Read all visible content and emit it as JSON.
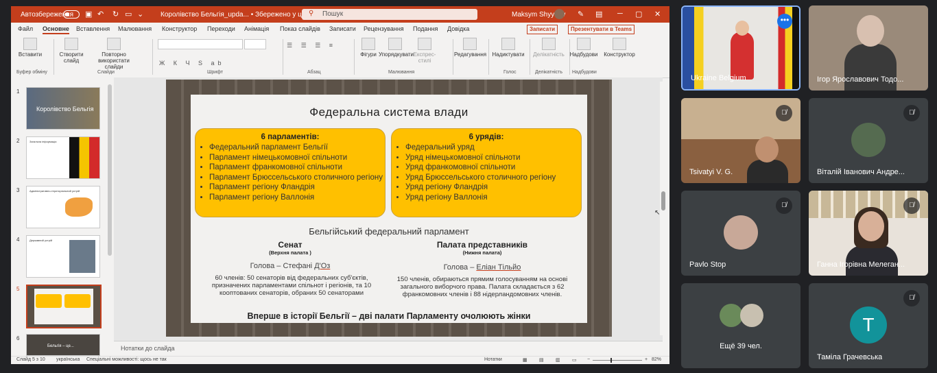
{
  "titlebar": {
    "autosave": "Автозбереження",
    "doc_title": "Королівство Бельгія_upda... • Збережено у цей ПК ⌄",
    "search_placeholder": "Пошук",
    "user": "Maksym Shyyaev"
  },
  "menu": {
    "items": [
      "Файл",
      "Основне",
      "Вставлення",
      "Малювання",
      "Конструктор",
      "Переходи",
      "Анімація",
      "Показ слайдів",
      "Записати",
      "Рецензування",
      "Подання",
      "Довідка"
    ],
    "record": "Записати",
    "present_teams": "Презентувати в Teams"
  },
  "ribbon": {
    "insert": "Вставити",
    "create_slide": "Створити слайд",
    "reuse": "Повторно використати слайди",
    "shapes": "Фігури",
    "arrange": "Упорядкувати",
    "express": "Експрес-стилі",
    "editing": "Редагування",
    "dictate": "Надиктувати",
    "sensitivity": "Делікатність",
    "addins": "Надбудови",
    "designer": "Конструктор",
    "groups": {
      "clipboard": "Буфер обміну",
      "slides": "Слайди",
      "font": "Шрифт",
      "paragraph": "Абзац",
      "drawing": "Малювання",
      "voice": "Голос",
      "sensitivity": "Делікатність",
      "addins": "Надбудови"
    }
  },
  "thumbnails": {
    "nums": [
      "1",
      "2",
      "3",
      "4",
      "5",
      "6"
    ],
    "t1_title": "Королівство Бельгія",
    "t2_title": "Загальна інформація",
    "t3_title": "Адміністративно-територіальний устрій",
    "t4_title": "Державний устрій",
    "t6_title": "Бельгія – це..."
  },
  "slide": {
    "title": "Федеральна система влади",
    "parliaments": {
      "heading": "6 парламентів:",
      "items": [
        "Федеральний парламент Бельгії",
        "Парламент німецькомовної спільноти",
        "Парламент франкомовної спільноти",
        "Парламент Брюссельського столичного регіону",
        "Парламент регіону Фландрія",
        "Парламент регіону Валлонія"
      ]
    },
    "governments": {
      "heading": "6 урядів:",
      "items": [
        "Федеральний уряд",
        "Уряд німецькомовної спільноти",
        "Уряд франкомовної спільноти",
        "Уряд Брюссельського столичного регіону",
        "Уряд регіону Фландрія",
        "Уряд регіону Валлонія"
      ]
    },
    "subtitle": "Бельгійський федеральний парламент",
    "senate": {
      "name": "Сенат",
      "note": "(Верхня палата )",
      "chair_prefix": "Голова – Стефані ",
      "chair_name": "Д'Оз",
      "text": "60 членів: 50 сенаторів від федеральних суб'єктів, призначених парламентами спільнот і регіонів, та 10 кооптованих сенаторів, обраних 50 сенаторами"
    },
    "chamber": {
      "name": "Палата представників",
      "note": "(Нижня палата)",
      "chair_prefix": "Голова – ",
      "chair_name": "Еліан Тільйо",
      "text": "150 членів, обираються прямим голосуванням на основі загального виборчого права. Палата складається з 62 франкомовних членів і 88 нідерландомовних членів."
    },
    "footer": "Вперше в історії Бельгії – дві палати Парламенту очолюють жінки"
  },
  "notes_placeholder": "Нотатки до слайда",
  "status": {
    "slide": "Слайд 5 з 10",
    "lang": "українська",
    "access": "Спеціальні можливості: щось не так",
    "notes": "Нотатки",
    "zoom": "82%"
  },
  "participants": [
    {
      "name": "Ukraine Belgium"
    },
    {
      "name": "Ігор Ярославович Тодо..."
    },
    {
      "name": "Tsivatyi V. G."
    },
    {
      "name": "Віталій Іванович Андре..."
    },
    {
      "name": "Pavlo Stop"
    },
    {
      "name": "Ганна Ігорівна Мелеган..."
    },
    {
      "name": "Ещё 39 чел."
    },
    {
      "name": "Таміла Грачевська",
      "initial": "T"
    }
  ],
  "colors": {
    "accent": "#c43e1c",
    "yellow": "#ffc000",
    "meet_bg": "#202124",
    "tile": "#3c4043"
  }
}
